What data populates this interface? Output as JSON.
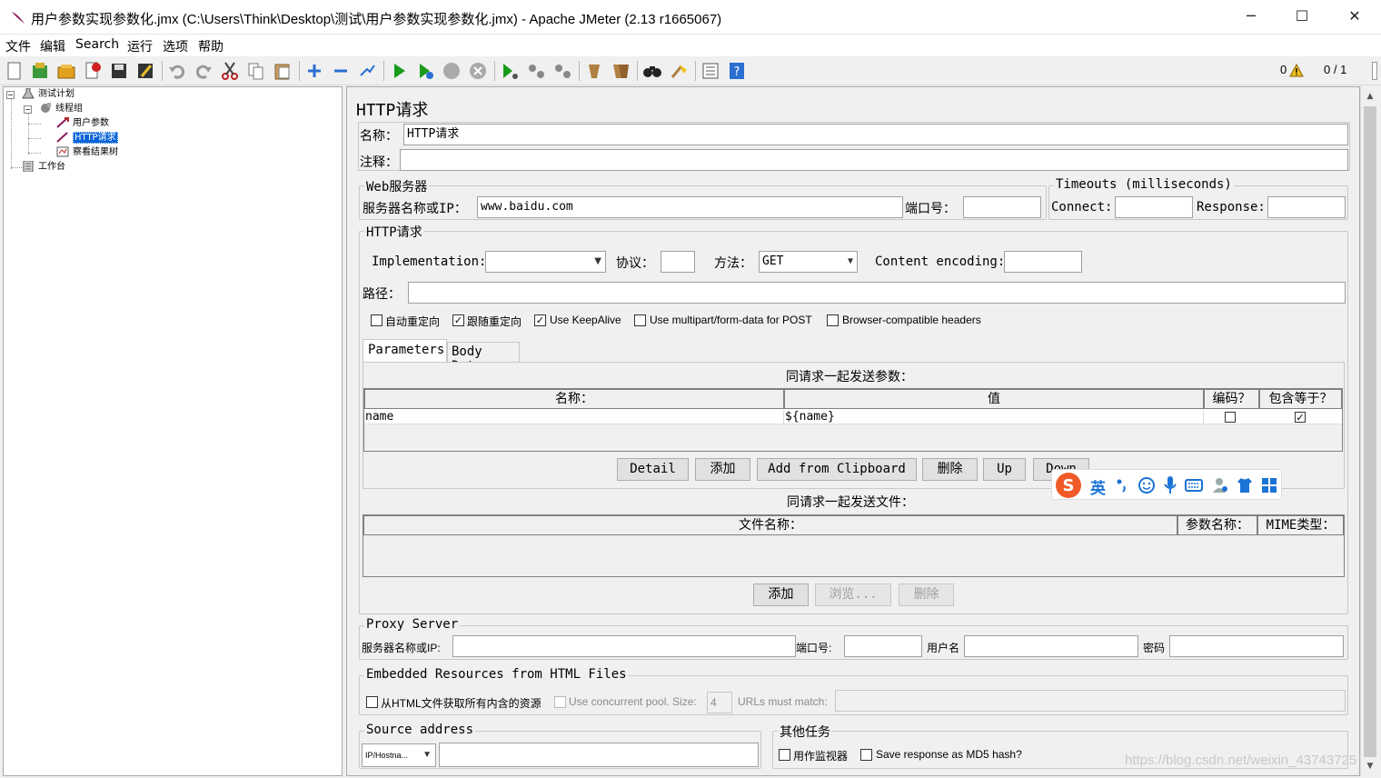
{
  "window": {
    "title": "用户参数实现参数化.jmx (C:\\Users\\Think\\Desktop\\测试\\用户参数实现参数化.jmx) - Apache JMeter (2.13 r1665067)",
    "minimize": "─",
    "maximize": "☐",
    "close": "✕"
  },
  "menu": [
    "文件",
    "编辑",
    "Search",
    "运行",
    "选项",
    "帮助"
  ],
  "toolbar": {
    "warning_count": "0",
    "threads": "0 / 1"
  },
  "tree": {
    "root": "测试计划",
    "thread_group": "线程组",
    "user_params": "用户参数",
    "http_request": "HTTP请求",
    "result_tree": "察看结果树",
    "workbench": "工作台"
  },
  "panel": {
    "title": "HTTP请求",
    "name_label": "名称：",
    "name_value": "HTTP请求",
    "comment_label": "注释：",
    "web_server": {
      "legend": "Web服务器",
      "server_label": "服务器名称或IP：",
      "server_value": "www.baidu.com",
      "port_label": "端口号："
    },
    "timeouts": {
      "legend": "Timeouts (milliseconds)",
      "connect_label": "Connect:",
      "response_label": "Response:"
    },
    "http": {
      "legend": "HTTP请求",
      "impl_label": "Implementation:",
      "protocol_label": "协议：",
      "method_label": "方法：",
      "method_value": "GET",
      "encoding_label": "Content encoding:",
      "path_label": "路径：",
      "options": {
        "auto_redirect": "自动重定向",
        "follow_redirect": "跟随重定向",
        "keepalive": "Use KeepAlive",
        "multipart": "Use multipart/form-data for POST",
        "browser_headers": "Browser-compatible headers"
      },
      "tabs": [
        "Parameters",
        "Body Data"
      ]
    },
    "params": {
      "caption": "同请求一起发送参数：",
      "headers": [
        "名称：",
        "值",
        "编码？",
        "包含等于？"
      ],
      "row": {
        "name": "name",
        "value": "${name}"
      },
      "buttons": [
        "Detail",
        "添加",
        "Add from Clipboard",
        "删除",
        "Up",
        "Down"
      ]
    },
    "files": {
      "caption": "同请求一起发送文件：",
      "headers": [
        "文件名称：",
        "参数名称：",
        "MIME类型："
      ],
      "buttons": [
        "添加",
        "浏览...",
        "删除"
      ]
    },
    "proxy": {
      "legend": "Proxy Server",
      "server_label": "服务器名称或IP:",
      "port_label": "端口号:",
      "user_label": "用户名",
      "password_label": "密码"
    },
    "embedded": {
      "legend": "Embedded Resources from HTML Files",
      "retrieve_label": "从HTML文件获取所有内含的资源",
      "pool_label": "Use concurrent pool. Size:",
      "pool_value": "4",
      "urls_label": "URLs must match:"
    },
    "source": {
      "legend": "Source address",
      "type_value": "IP/Hostna..."
    },
    "other": {
      "legend": "其他任务",
      "monitor_label": "用作监视器",
      "md5_label": "Save response as MD5 hash?"
    }
  },
  "ime": {
    "lang": "英"
  },
  "watermark": "https://blog.csdn.net/weixin_43743725",
  "colors": {
    "selection": "#0a64d8",
    "play": "#1a9a1a",
    "help": "#2a6fd0"
  }
}
